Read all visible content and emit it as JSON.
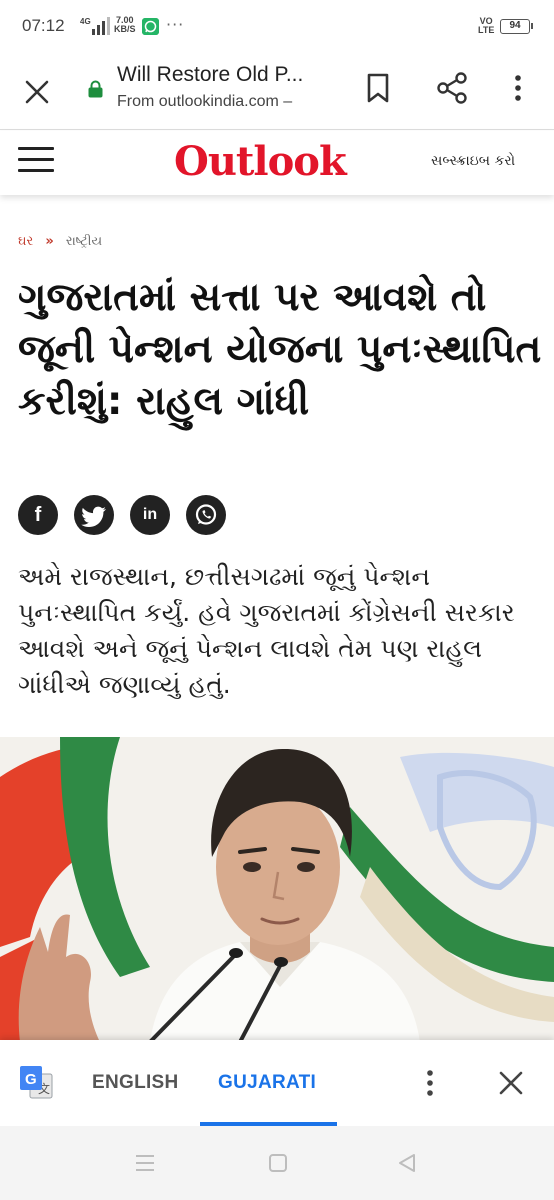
{
  "status_bar": {
    "time": "07:12",
    "network": "4G",
    "speed_value": "7.00",
    "speed_unit": "KB/S",
    "overflow": "···",
    "volte_top": "VO",
    "volte_bottom": "LTE",
    "battery": "94"
  },
  "browser": {
    "title": "Will Restore Old P...",
    "source": "From outlookindia.com –"
  },
  "site": {
    "logo": "Outlook",
    "subscribe_label": "સબ્સ્ક્રાઇબ કરો"
  },
  "article": {
    "breadcrumb": {
      "home": "ઘર",
      "separator": "»",
      "category": "રાષ્ટ્રીય"
    },
    "headline": "ગુજરાતમાં સત્તા પર આવશે તો જૂની પેન્શન યોજના પુનઃસ્થાપિત કરીશું: રાહુલ ગાંધી",
    "share": {
      "facebook": "f",
      "twitter": "t",
      "linkedin": "in",
      "whatsapp": "w"
    },
    "summary": "અમે રાજસ્થાન, છત્તીસગઢમાં જૂનું પેન્શન પુનઃસ્થાપિત કર્યું. હવે ગુજરાતમાં કોંગ્રેસની સરકાર આવશે અને જૂનું પેન્શન લાવશે તેમ પણ રાહુલ ગાંધીએ જણાવ્યું હતું."
  },
  "translate_bar": {
    "tab_english": "ENGLISH",
    "tab_gujarati": "GUJARATI",
    "selected": "GUJARATI"
  },
  "colors": {
    "brand_red": "#e2152a",
    "translate_blue": "#1a73e8",
    "icon_dark": "#222222"
  }
}
